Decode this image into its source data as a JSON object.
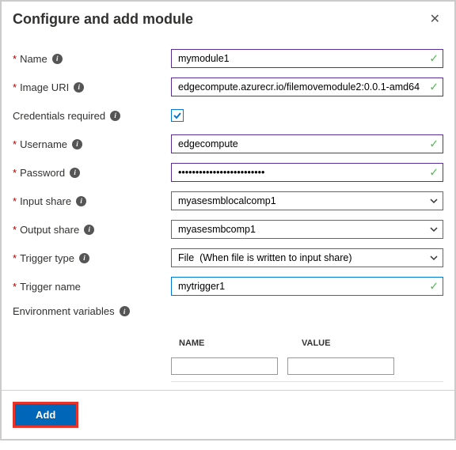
{
  "header": {
    "title": "Configure and add module"
  },
  "fields": {
    "name": {
      "label": "Name",
      "value": "mymodule1",
      "required": true,
      "info": true
    },
    "imageUri": {
      "label": "Image URI",
      "value": "edgecompute.azurecr.io/filemovemodule2:0.0.1-amd64",
      "required": true,
      "info": true
    },
    "credentials": {
      "label": "Credentials required",
      "checked": true,
      "info": true
    },
    "username": {
      "label": "Username",
      "value": "edgecompute",
      "required": true,
      "info": true
    },
    "password": {
      "label": "Password",
      "value": "•••••••••••••••••••••••••",
      "required": true,
      "info": true
    },
    "inputShare": {
      "label": "Input share",
      "value": "myasesmblocalcomp1",
      "required": true,
      "info": true
    },
    "outputShare": {
      "label": "Output share",
      "value": "myasesmbcomp1",
      "required": true,
      "info": true
    },
    "triggerType": {
      "label": "Trigger type",
      "value": "File  (When file is written to input share)",
      "required": true,
      "info": true
    },
    "triggerName": {
      "label": "Trigger name",
      "value": "mytrigger1",
      "required": true
    },
    "envVars": {
      "label": "Environment variables",
      "info": true
    }
  },
  "envTable": {
    "headers": {
      "name": "NAME",
      "value": "VALUE"
    },
    "rows": [
      {
        "name": "",
        "value": ""
      }
    ]
  },
  "footer": {
    "addLabel": "Add"
  }
}
